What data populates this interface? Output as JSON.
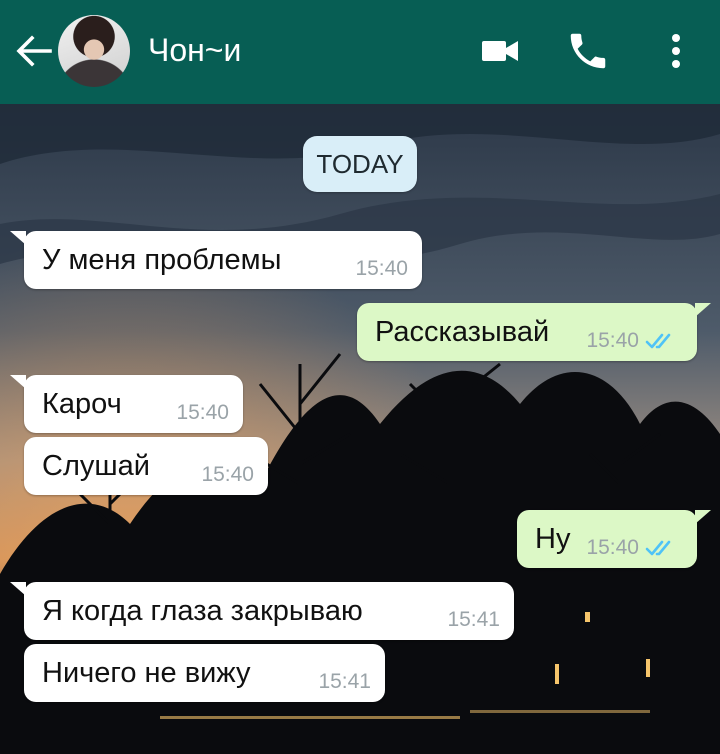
{
  "header": {
    "contact_name": "Чон~и",
    "background_color": "#075e54"
  },
  "icons": {
    "back": "arrow-left-icon",
    "avatar": "avatar",
    "video": "videocam-icon",
    "call": "phone-icon",
    "menu": "more-vertical-icon",
    "read": "double-check-icon"
  },
  "date_chip": "TODAY",
  "messages": [
    {
      "direction": "incoming",
      "text": "У меня проблемы",
      "time": "15:40"
    },
    {
      "direction": "outgoing",
      "text": "Рассказывай",
      "time": "15:40",
      "status": "read"
    },
    {
      "direction": "incoming",
      "text": "Кароч",
      "time": "15:40"
    },
    {
      "direction": "incoming",
      "text": "Слушай",
      "time": "15:40"
    },
    {
      "direction": "outgoing",
      "text": "Ну",
      "time": "15:40",
      "status": "read"
    },
    {
      "direction": "incoming",
      "text": "Я когда глаза закрываю",
      "time": "15:41"
    },
    {
      "direction": "incoming",
      "text": "Ничего не вижу",
      "time": "15:41"
    }
  ],
  "colors": {
    "incoming_bubble": "#ffffff",
    "outgoing_bubble": "#dcf8c6",
    "read_ticks": "#4fc3f7",
    "date_chip": "#d9eef8"
  }
}
